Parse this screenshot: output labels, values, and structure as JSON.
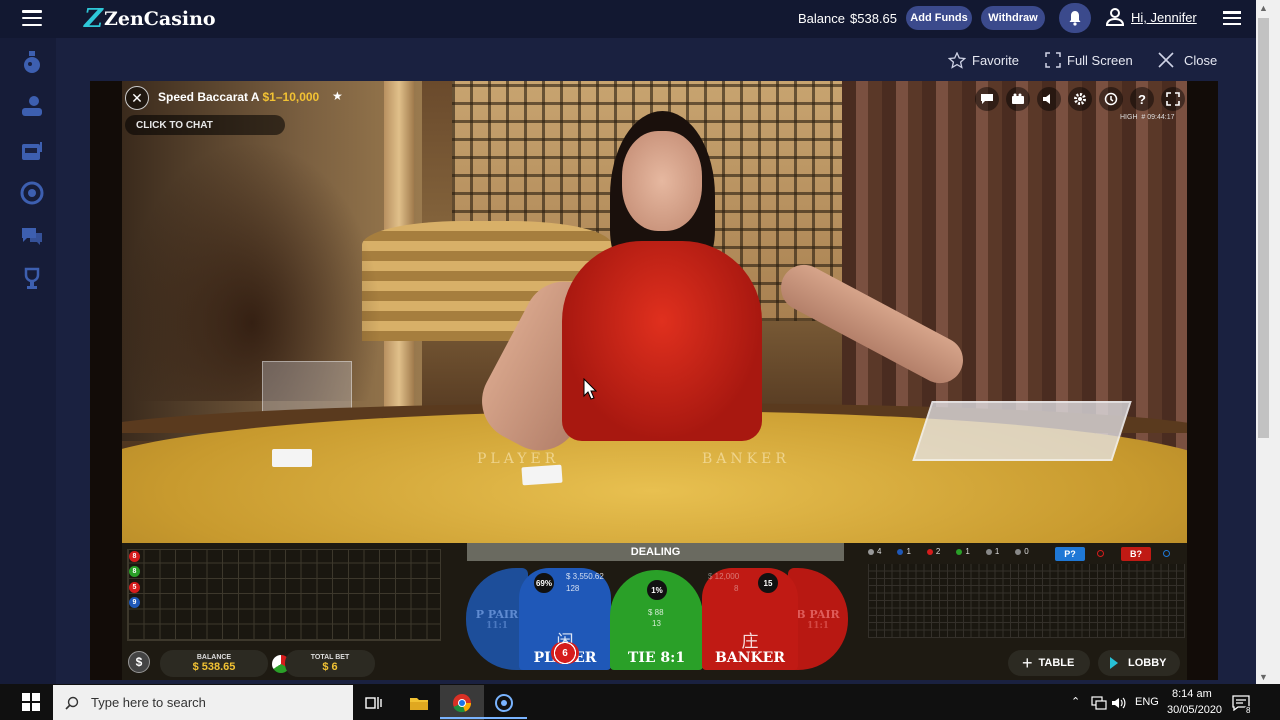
{
  "header": {
    "logo_mark": "Z",
    "logo_text": "ZenCasino",
    "balance_label": "Balance",
    "balance_value": "$538.65",
    "add_funds_label": "Add Funds",
    "withdraw_label": "Withdraw",
    "greeting": "Hi, Jennifer"
  },
  "game_actions": {
    "favorite_label": "Favorite",
    "fullscreen_label": "Full Screen",
    "close_label": "Close"
  },
  "game": {
    "table_name": "Speed Baccarat A",
    "limits": "$1–10,000",
    "chat_label": "CLICK TO CHAT",
    "quality": "HIGH",
    "round_id": "# 09:44:17",
    "status": "DEALING",
    "table_labels": [
      "PLAYER",
      "BANKER"
    ],
    "roadmap_dots": [
      {
        "value": "8",
        "color": "#d61c1c"
      },
      {
        "value": "8",
        "color": "#2aa028"
      },
      {
        "value": "5",
        "color": "#d61c1c"
      },
      {
        "value": "9",
        "color": "#1f58b8"
      }
    ],
    "stats": [
      {
        "value": "4",
        "color": "#999999",
        "label": "#"
      },
      {
        "value": "1",
        "color": "#1f58b8"
      },
      {
        "value": "2",
        "color": "#d61c1c"
      },
      {
        "value": "1",
        "color": "#2aa028"
      },
      {
        "value": "1",
        "color": "#888888"
      },
      {
        "value": "0",
        "color": "#888888"
      }
    ],
    "predict_player": "P?",
    "predict_banker": "B?",
    "zones": {
      "player_pair": {
        "label": "P PAIR",
        "payout": "11:1"
      },
      "player": {
        "label": "PLAYER",
        "glyph": "闲",
        "pct": "69%",
        "amount": "$ 3,550.62",
        "players": "128"
      },
      "tie": {
        "label": "TIE 8:1",
        "pct": "1%",
        "amount": "$ 88",
        "players": "13"
      },
      "banker": {
        "label": "BANKER",
        "glyph": "庄",
        "pct": "15",
        "amount": "$ 12,000",
        "players": "8"
      },
      "banker_pair": {
        "label": "B PAIR",
        "payout": "11:1"
      }
    },
    "chip_value": "6",
    "balance_label": "BALANCE",
    "balance_value": "$ 538.65",
    "total_bet_label": "TOTAL BET",
    "total_bet_value": "$ 6",
    "table_btn_label": "TABLE",
    "lobby_btn_label": "LOBBY"
  },
  "taskbar": {
    "search_placeholder": "Type here to search",
    "language": "ENG",
    "time": "8:14 am",
    "date": "30/05/2020",
    "notifications": "8"
  },
  "colors": {
    "accent": "#3b4a8c",
    "brand": "#2ec7d8",
    "gold": "#f2c233",
    "player": "#1f58b8",
    "tie": "#2aa028",
    "banker": "#c01a14"
  }
}
